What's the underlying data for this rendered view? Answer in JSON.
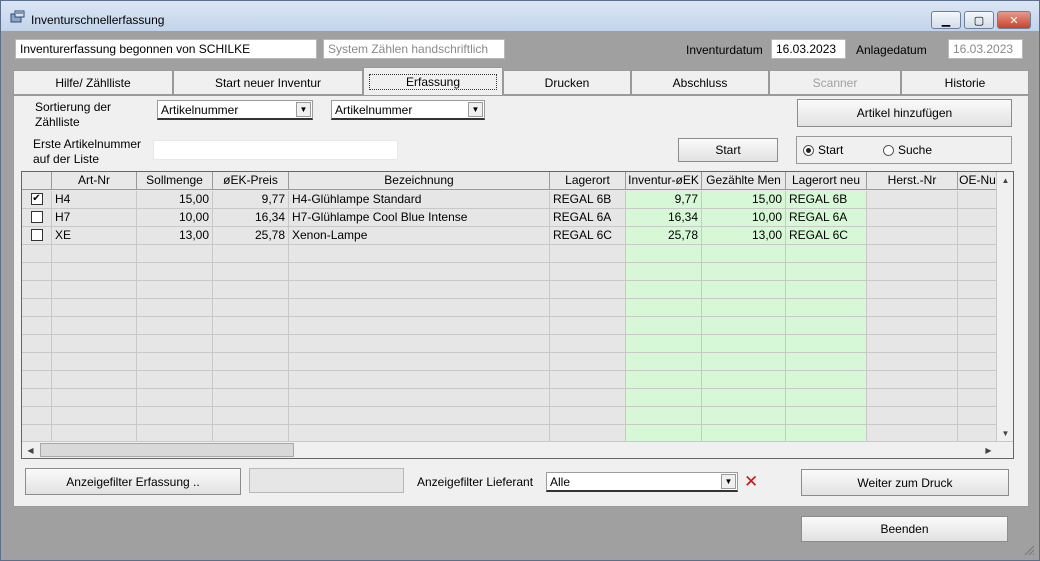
{
  "window": {
    "title": "Inventurschnellerfassung"
  },
  "header": {
    "started_by": "Inventurerfassung begonnen von SCHILKE",
    "system_count": "System Zählen handschriftlich",
    "inventory_date_label": "Inventurdatum",
    "inventory_date": "16.03.2023",
    "creation_date_label": "Anlagedatum",
    "creation_date": "16.03.2023"
  },
  "tabs": [
    {
      "label": "Hilfe/ Zählliste"
    },
    {
      "label": "Start neuer Inventur"
    },
    {
      "label": "Erfassung"
    },
    {
      "label": "Drucken"
    },
    {
      "label": "Abschluss"
    },
    {
      "label": "Scanner"
    },
    {
      "label": "Historie"
    }
  ],
  "controls": {
    "sort_label": "Sortierung der Zählliste",
    "sort_value1": "Artikelnummer",
    "sort_value2": "Artikelnummer",
    "first_item_label": "Erste Artikelnummer auf der Liste",
    "first_item_value": "",
    "start_button": "Start",
    "add_article_button": "Artikel hinzufügen",
    "radio_start": "Start",
    "radio_search": "Suche"
  },
  "grid": {
    "columns": [
      "",
      "Art-Nr",
      "Sollmenge",
      "øEK-Preis",
      "Bezeichnung",
      "Lagerort",
      "Inventur-øEK",
      "Gezählte Men",
      "Lagerort neu",
      "Herst.-Nr",
      "OE-Nu"
    ],
    "rows": [
      {
        "checked": true,
        "art_nr": "H4",
        "soll": "15,00",
        "ek": "9,77",
        "bez": "H4-Glühlampe Standard",
        "lager": "REGAL 6B",
        "inv_ek": "9,77",
        "gezaehlt": "15,00",
        "lager_neu": "REGAL 6B",
        "herst": "",
        "oe": ""
      },
      {
        "checked": false,
        "art_nr": "H7",
        "soll": "10,00",
        "ek": "16,34",
        "bez": "H7-Glühlampe Cool Blue Intense",
        "lager": "REGAL 6A",
        "inv_ek": "16,34",
        "gezaehlt": "10,00",
        "lager_neu": "REGAL 6A",
        "herst": "",
        "oe": ""
      },
      {
        "checked": false,
        "art_nr": "XE",
        "soll": "13,00",
        "ek": "25,78",
        "bez": "Xenon-Lampe",
        "lager": "REGAL 6C",
        "inv_ek": "25,78",
        "gezaehlt": "13,00",
        "lager_neu": "REGAL 6C",
        "herst": "",
        "oe": ""
      }
    ]
  },
  "footer": {
    "filter_button": "Anzeigefilter Erfassung ..",
    "filter_value": "",
    "supplier_filter_label": "Anzeigefilter Lieferant",
    "supplier_filter_value": "Alle",
    "print_button": "Weiter zum Druck",
    "exit_button": "Beenden"
  },
  "colors": {
    "green_cells": "#d6f8d6",
    "clear_filter_icon": "#c21818"
  }
}
